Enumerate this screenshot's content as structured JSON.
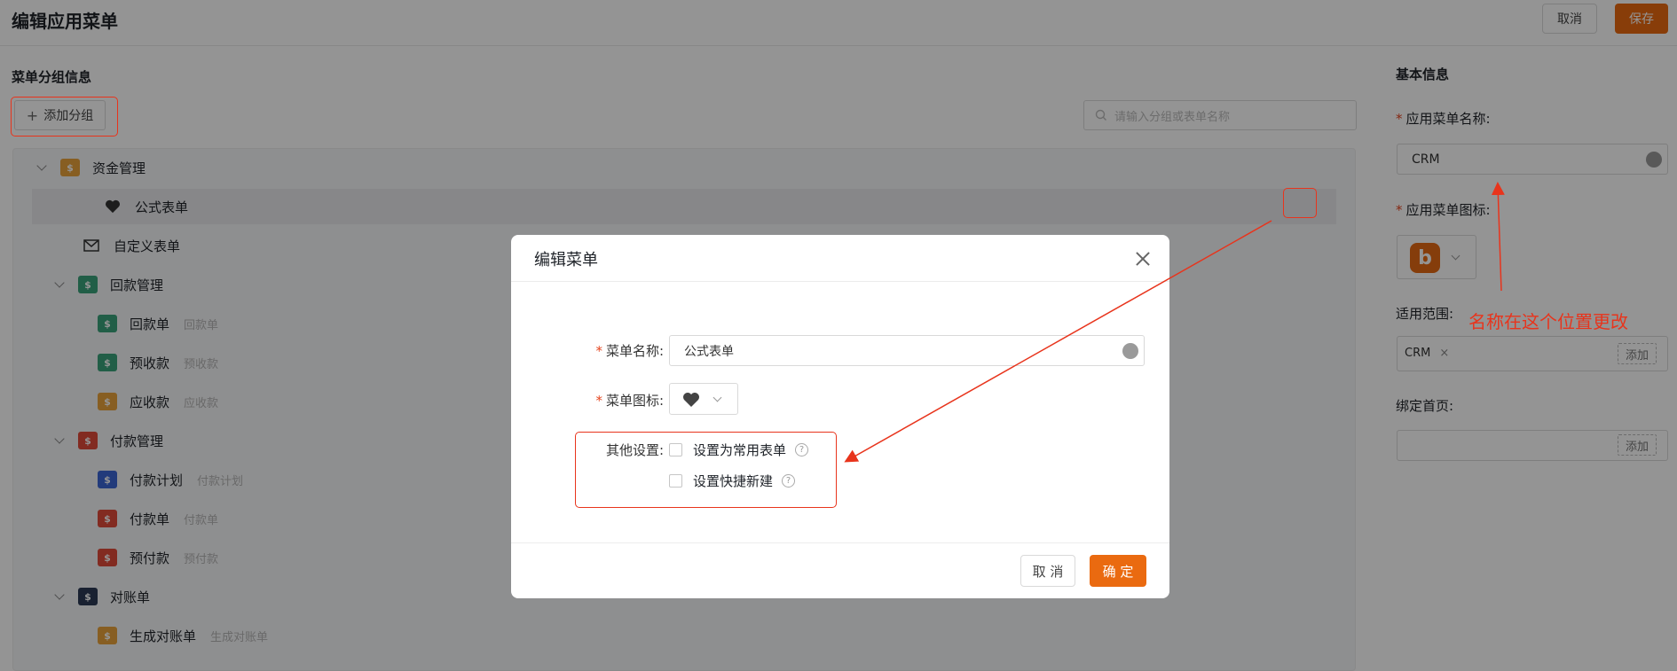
{
  "header": {
    "title": "编辑应用菜单",
    "cancel_label": "取消",
    "save_label": "保存"
  },
  "left": {
    "section_title": "菜单分组信息",
    "add_group_label": "添加分组",
    "search_placeholder": "请输入分组或表单名称",
    "tree": [
      {
        "label": "资金管理",
        "sub": "",
        "icon": "folder-coin-icon",
        "color": "#e9a23b"
      },
      {
        "label": "公式表单",
        "sub": "",
        "icon": "heart-icon",
        "color": "#333333"
      },
      {
        "label": "自定义表单",
        "sub": "",
        "icon": "mail-icon",
        "color": "#333333"
      },
      {
        "label": "回款管理",
        "sub": "",
        "icon": "money-in-icon",
        "color": "#3aa27a"
      },
      {
        "label": "回款单",
        "sub": "回款单",
        "icon": "money-in-icon",
        "color": "#3aa27a"
      },
      {
        "label": "预收款",
        "sub": "预收款",
        "icon": "money-in-icon",
        "color": "#3aa27a"
      },
      {
        "label": "应收款",
        "sub": "应收款",
        "icon": "receivable-icon",
        "color": "#e9a23b"
      },
      {
        "label": "付款管理",
        "sub": "",
        "icon": "money-out-icon",
        "color": "#e04b3a"
      },
      {
        "label": "付款计划",
        "sub": "付款计划",
        "icon": "plan-icon",
        "color": "#3b66d4"
      },
      {
        "label": "付款单",
        "sub": "付款单",
        "icon": "money-out-icon",
        "color": "#e04b3a"
      },
      {
        "label": "预付款",
        "sub": "预付款",
        "icon": "money-out-icon",
        "color": "#e04b3a"
      },
      {
        "label": "对账单",
        "sub": "",
        "icon": "checklist-icon",
        "color": "#2b3a55"
      },
      {
        "label": "生成对账单",
        "sub": "生成对账单",
        "icon": "generate-icon",
        "color": "#e9a23b"
      }
    ]
  },
  "right": {
    "section_title": "基本信息",
    "app_name_label": "应用菜单名称:",
    "app_name_value": "CRM",
    "app_icon_label": "应用菜单图标:",
    "app_icon_letter": "b",
    "scope_label": "适用范围:",
    "scope_tag": "CRM",
    "scope_tag_remove": "×",
    "scope_add": "添加",
    "homepage_label": "绑定首页:",
    "homepage_add": "添加"
  },
  "annotation": {
    "text": "名称在这个位置更改",
    "color": "#e8341c"
  },
  "modal": {
    "title": "编辑菜单",
    "name_label": "菜单名称:",
    "name_value": "公式表单",
    "icon_label": "菜单图标:",
    "other_label": "其他设置:",
    "option_common": "设置为常用表单",
    "option_quick": "设置快捷新建",
    "help": "?",
    "cancel_label": "取 消",
    "ok_label": "确 定",
    "accent": "#ea6a10"
  }
}
